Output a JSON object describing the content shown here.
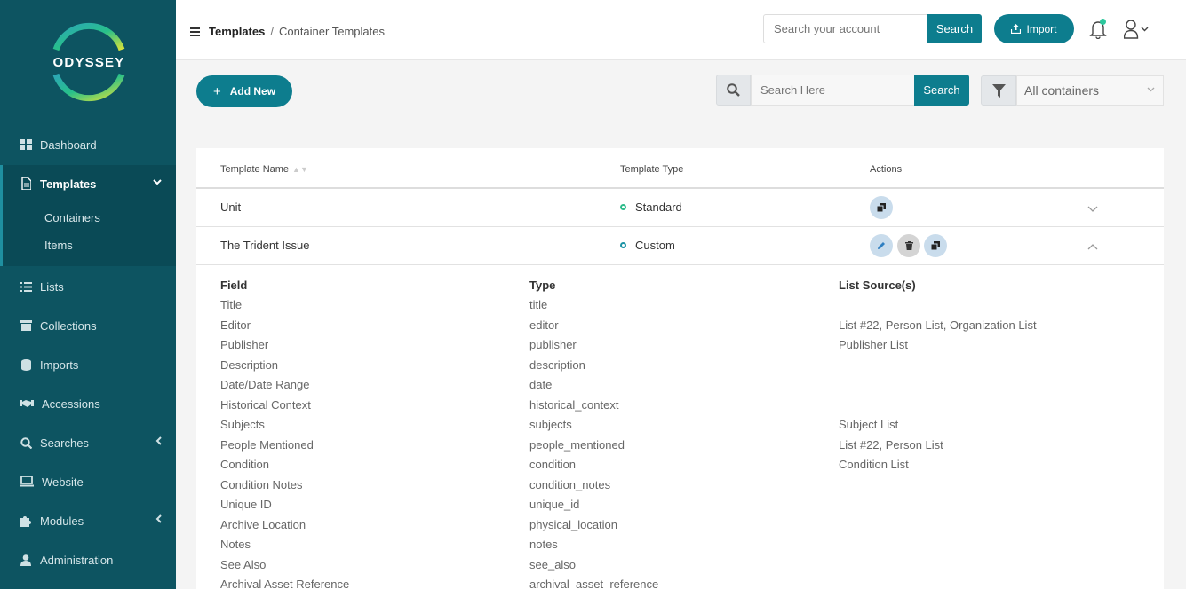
{
  "sidebar": {
    "logo_text": "ODYSSEY",
    "items": [
      {
        "label": "Dashboard",
        "icon": "dashboard-icon"
      },
      {
        "label": "Templates",
        "icon": "document-icon"
      },
      {
        "label": "Lists",
        "icon": "list-icon"
      },
      {
        "label": "Collections",
        "icon": "archive-icon"
      },
      {
        "label": "Imports",
        "icon": "database-icon"
      },
      {
        "label": "Accessions",
        "icon": "handshake-icon"
      },
      {
        "label": "Searches",
        "icon": "search-icon"
      },
      {
        "label": "Website",
        "icon": "laptop-icon"
      },
      {
        "label": "Modules",
        "icon": "puzzle-icon"
      },
      {
        "label": "Administration",
        "icon": "user-icon"
      }
    ],
    "subitems": [
      "Containers",
      "Items"
    ]
  },
  "header": {
    "breadcrumb": [
      "Templates",
      "Container Templates"
    ],
    "search_placeholder": "Search your account",
    "search_label": "Search",
    "import_label": "Import"
  },
  "toolbar": {
    "add_label": "Add New",
    "search_placeholder": "Search Here",
    "search_label": "Search",
    "filter_value": "All containers"
  },
  "table": {
    "headers": [
      "Template Name",
      "Template Type",
      "Actions"
    ],
    "rows": [
      {
        "name": "Unit",
        "type": "Standard",
        "type_color": "#2dbb8a"
      },
      {
        "name": "The Trident Issue",
        "type": "Custom",
        "type_color": "#1a93a5"
      }
    ]
  },
  "detail": {
    "headers": [
      "Field",
      "Type",
      "List Source(s)"
    ],
    "rows": [
      {
        "field": "Title",
        "type": "title",
        "source": ""
      },
      {
        "field": "Editor",
        "type": "editor",
        "source": "List #22, Person List, Organization List"
      },
      {
        "field": "Publisher",
        "type": "publisher",
        "source": "Publisher List"
      },
      {
        "field": "Description",
        "type": "description",
        "source": ""
      },
      {
        "field": "Date/Date Range",
        "type": "date",
        "source": ""
      },
      {
        "field": "Historical Context",
        "type": "historical_context",
        "source": ""
      },
      {
        "field": "Subjects",
        "type": "subjects",
        "source": "Subject List"
      },
      {
        "field": "People Mentioned",
        "type": "people_mentioned",
        "source": "List #22, Person List"
      },
      {
        "field": "Condition",
        "type": "condition",
        "source": "Condition List"
      },
      {
        "field": "Condition Notes",
        "type": "condition_notes",
        "source": ""
      },
      {
        "field": "Unique ID",
        "type": "unique_id",
        "source": ""
      },
      {
        "field": "Archive Location",
        "type": "physical_location",
        "source": ""
      },
      {
        "field": "Notes",
        "type": "notes",
        "source": ""
      },
      {
        "field": "See Also",
        "type": "see_also",
        "source": ""
      },
      {
        "field": "Archival Asset Reference",
        "type": "archival_asset_reference",
        "source": ""
      }
    ]
  },
  "colors": {
    "sidebar": "#0d5461",
    "accent": "#0d7d8e",
    "notification": "#2dc79d"
  }
}
